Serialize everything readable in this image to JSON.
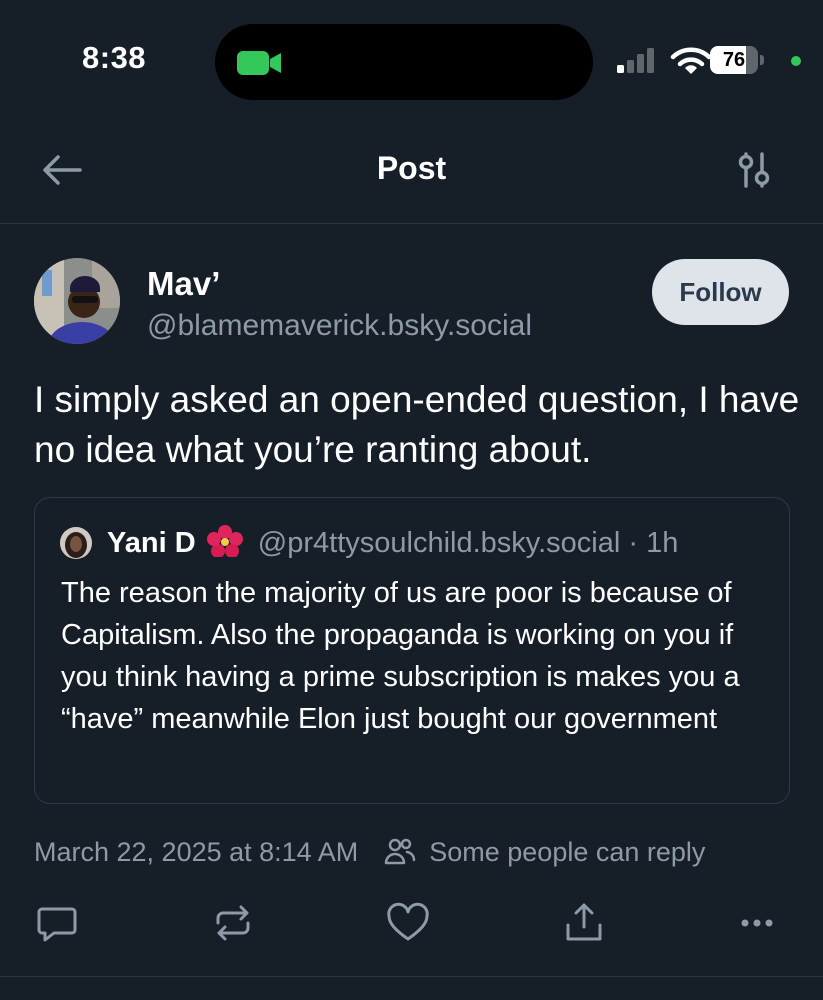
{
  "status_bar": {
    "time": "8:38",
    "battery_level": "76",
    "battery_fraction": 0.76,
    "icons": [
      "facetime-camera-icon",
      "cellular-signal-icon",
      "wifi-icon",
      "battery-icon"
    ]
  },
  "nav": {
    "title": "Post",
    "back_icon": "arrow-left-icon",
    "settings_icon": "sliders-icon"
  },
  "post": {
    "author_name": "Mav’",
    "author_handle": "@blamemaverick.bsky.social",
    "follow_label": "Follow",
    "text": "I simply asked an open-ended question, I have no idea what you’re ranting about.",
    "quote": {
      "author_name": "Yani D",
      "author_emoji": "hibiscus",
      "author_handle": "@pr4ttysoulchild.bsky.social",
      "separator": " · ",
      "age": "1h",
      "text": "The reason the majority of us are poor is because of Capitalism. Also the propaganda is working on you if you think having a prime subscription is makes you a “have” meanwhile Elon just bought our government"
    },
    "timestamp": "March 22, 2025 at 8:14 AM",
    "reply_setting": "Some people can reply",
    "actions": [
      "reply-icon",
      "repost-icon",
      "like-icon",
      "share-icon",
      "more-icon"
    ]
  },
  "colors": {
    "background": "#161e27",
    "muted_text": "#8d9aa8",
    "follow_bg": "#dfe4ea",
    "accent_green": "#34c759"
  }
}
